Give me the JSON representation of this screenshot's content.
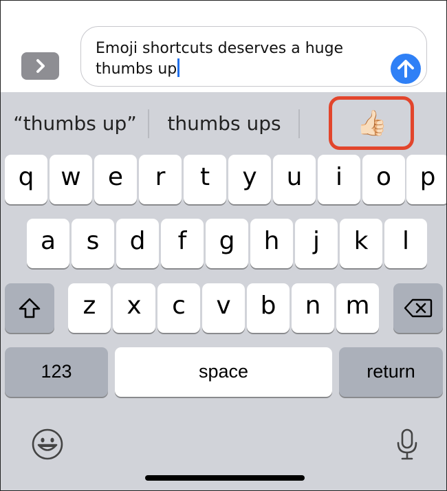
{
  "compose": {
    "message_text": "Emoji shortcuts deserves a huge\nthumbs up",
    "apps_button_icon": "chevron-right-icon",
    "send_button_icon": "arrow-up-icon",
    "send_color": "#2f80f6"
  },
  "predictive_bar": {
    "suggestions": [
      "“thumbs up”",
      "thumbs ups"
    ],
    "emoji_suggestion": "👍🏻",
    "emoji_name": "thumbs-up-light-skin-emoji",
    "highlight_color": "#e2452c"
  },
  "keyboard": {
    "row1": [
      "q",
      "w",
      "e",
      "r",
      "t",
      "y",
      "u",
      "i",
      "o",
      "p"
    ],
    "row2": [
      "a",
      "s",
      "d",
      "f",
      "g",
      "h",
      "j",
      "k",
      "l"
    ],
    "row3": [
      "z",
      "x",
      "c",
      "v",
      "b",
      "n",
      "m"
    ],
    "shift_icon": "shift-icon",
    "delete_icon": "delete-backspace-icon",
    "numbers_label": "123",
    "space_label": "space",
    "return_label": "return",
    "emoji_icon": "emoji-keyboard-icon",
    "mic_icon": "microphone-icon"
  }
}
